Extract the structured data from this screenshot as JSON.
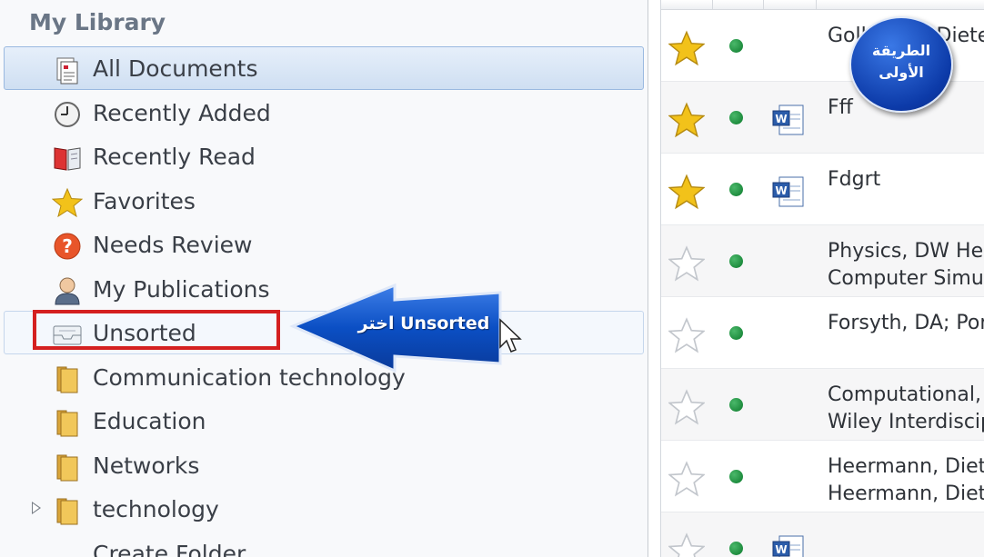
{
  "sidebar": {
    "title": "My Library",
    "items": [
      {
        "label": "All Documents",
        "icon": "all-documents-icon"
      },
      {
        "label": "Recently Added",
        "icon": "clock-icon"
      },
      {
        "label": "Recently Read",
        "icon": "open-book-icon"
      },
      {
        "label": "Favorites",
        "icon": "star-icon"
      },
      {
        "label": "Needs Review",
        "icon": "question-icon"
      },
      {
        "label": "My Publications",
        "icon": "person-icon"
      },
      {
        "label": "Unsorted",
        "icon": "inbox-tray-icon"
      },
      {
        "label": "Communication technology",
        "icon": "folder-icon"
      },
      {
        "label": "Education",
        "icon": "folder-icon"
      },
      {
        "label": "Networks",
        "icon": "folder-icon"
      },
      {
        "label": "technology",
        "icon": "folder-icon"
      },
      {
        "label": "Create Folder...",
        "icon": ""
      }
    ]
  },
  "callout": {
    "text": "اختر Unsorted",
    "color": "#0b4fc4"
  },
  "badge": {
    "line1": "الطريقة",
    "line2": "الأولى",
    "color": "#0c3aa8"
  },
  "documents": [
    {
      "favorite": true,
      "read_status": "green-dot",
      "has_file": false,
      "line1": "Gollmann, Dieter",
      "line2": ""
    },
    {
      "favorite": true,
      "read_status": "green-dot",
      "has_file": true,
      "line1": "Fff",
      "line2": ""
    },
    {
      "favorite": true,
      "read_status": "green-dot",
      "has_file": true,
      "line1": "Fdgrt",
      "line2": ""
    },
    {
      "favorite": false,
      "read_status": "green-dot",
      "has_file": false,
      "line1": "Physics, DW Heermann",
      "line2": "Computer Simulation"
    },
    {
      "favorite": false,
      "read_status": "green-dot",
      "has_file": false,
      "line1": "Forsyth, DA; Ponce",
      "line2": ""
    },
    {
      "favorite": false,
      "read_status": "green-dot",
      "has_file": false,
      "line1": "Computational,",
      "line2": "Wiley Interdisciplinary"
    },
    {
      "favorite": false,
      "read_status": "green-dot",
      "has_file": false,
      "line1": "Heermann, Dieter",
      "line2": "Heermann, Dieter"
    },
    {
      "favorite": false,
      "read_status": "green-dot",
      "has_file": true,
      "line1": "",
      "line2": ""
    }
  ],
  "colors": {
    "selection": "#cfdff2",
    "highlight_box": "#d42020",
    "star": "#f2c21a",
    "read_dot": "#129a3c"
  }
}
